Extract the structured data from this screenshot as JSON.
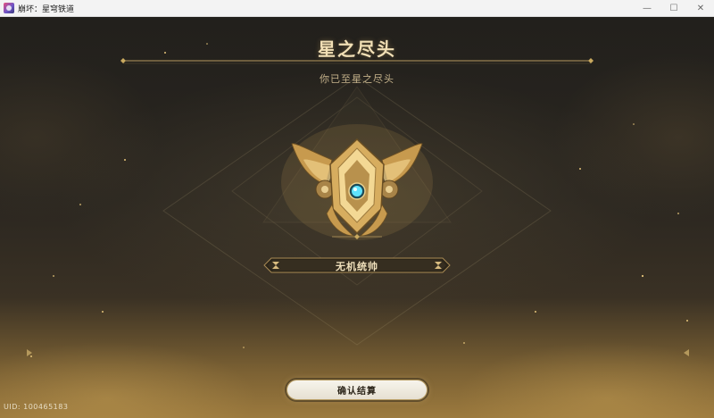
{
  "window": {
    "title": "崩坏：星穹铁道",
    "icon": "app-icon",
    "controls": {
      "minimize": "—",
      "maximize": "☐",
      "close": "✕"
    }
  },
  "screen": {
    "title": "星之尽头",
    "subtitle": "你已至星之尽头",
    "rank": {
      "name": "无机统帅",
      "emblem": "winged-crest-emblem"
    },
    "confirm_button": "确认结算",
    "uid": "UID: 100465183"
  },
  "colors": {
    "gold_text": "#f1dfb5",
    "accent_gold": "#c9a95f",
    "button_bg": "#f2eee4",
    "gem_cyan": "#5fe3ff"
  }
}
